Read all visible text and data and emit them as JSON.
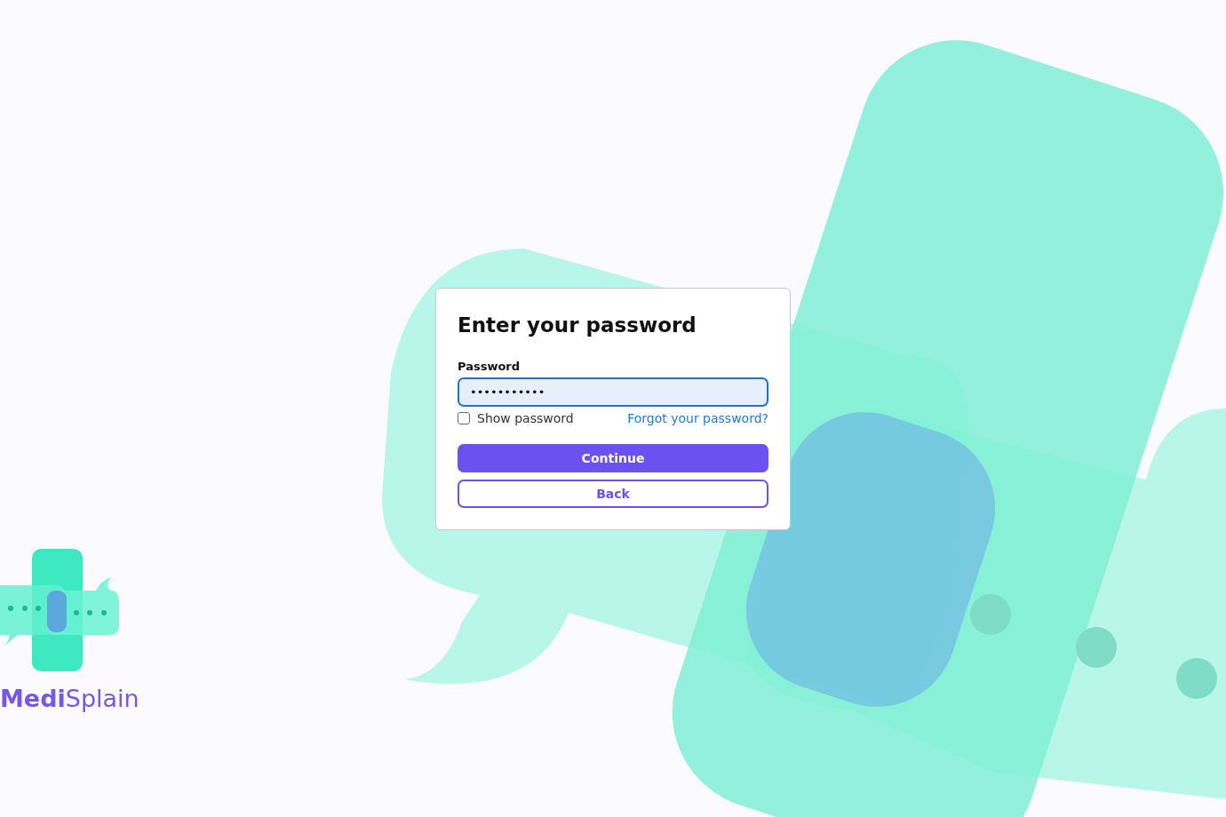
{
  "brand": {
    "name": "**Medi**Splain"
  },
  "dialog": {
    "title": "Enter your password",
    "field": {
      "label": "Password",
      "value": "•••••••••••",
      "focused": true
    },
    "show_password": {
      "label": "Show password",
      "checked": false
    },
    "forgot_link": "Forgot your password?",
    "buttons": [
      {
        "label": "Continue",
        "kind": "primary"
      },
      {
        "label": "Back",
        "kind": "secondary"
      }
    ]
  }
}
